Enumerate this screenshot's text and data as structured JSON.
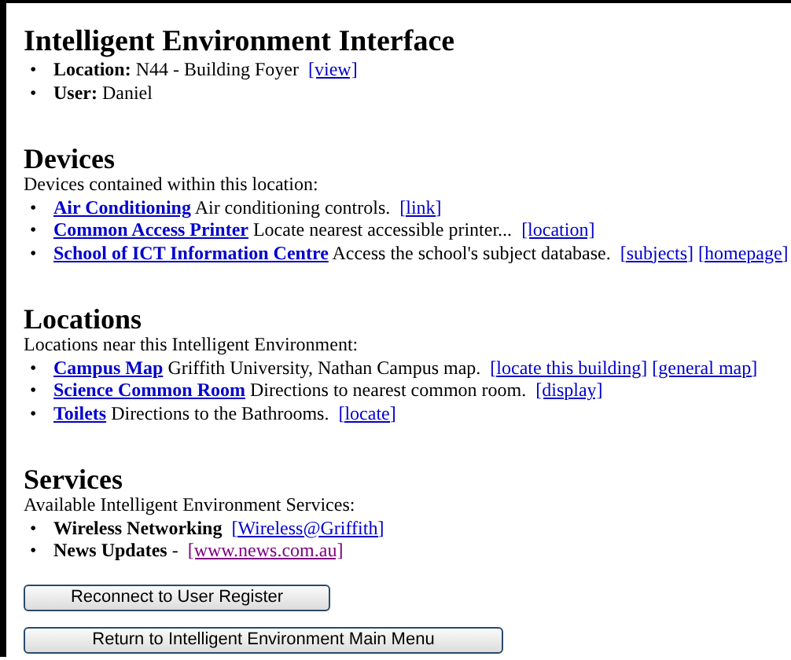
{
  "title": "Intelligent Environment Interface",
  "info": [
    {
      "bullet": "•",
      "label": "Location:",
      "text": "N44 - Building Foyer",
      "links": [
        {
          "label": "[view]",
          "visited": false
        }
      ]
    },
    {
      "bullet": "•",
      "label": "User:",
      "text": "Daniel"
    }
  ],
  "sections": [
    {
      "heading": "Devices",
      "intro": "Devices contained within this location:",
      "items": [
        {
          "bullet": "•",
          "title": "Air Conditioning",
          "title_link": true,
          "text": "Air conditioning controls.",
          "links": [
            {
              "label": "[link]",
              "visited": false
            }
          ]
        },
        {
          "bullet": "•",
          "title": "Common Access Printer",
          "title_link": true,
          "text": "Locate nearest accessible printer...",
          "links": [
            {
              "label": "[location]",
              "visited": false
            }
          ]
        },
        {
          "bullet": "•",
          "title": "School of ICT Information Centre",
          "title_link": true,
          "text": "Access the school's subject database.",
          "links": [
            {
              "label": "[subjects]",
              "visited": false
            },
            {
              "label": "[homepage]",
              "visited": false
            }
          ]
        }
      ]
    },
    {
      "heading": "Locations",
      "intro": "Locations near this Intelligent Environment:",
      "items": [
        {
          "bullet": "•",
          "title": "Campus Map",
          "title_link": true,
          "text": "Griffith University, Nathan Campus map.",
          "links": [
            {
              "label": "[locate this building]",
              "visited": false
            },
            {
              "label": "[general map]",
              "visited": false
            }
          ]
        },
        {
          "bullet": "•",
          "title": "Science Common Room",
          "title_link": true,
          "text": "Directions to nearest common room.",
          "links": [
            {
              "label": "[display]",
              "visited": false
            }
          ]
        },
        {
          "bullet": "•",
          "title": "Toilets",
          "title_link": true,
          "text": "Directions to the Bathrooms.",
          "links": [
            {
              "label": "[locate]",
              "visited": false
            }
          ]
        }
      ]
    },
    {
      "heading": "Services",
      "intro": "Available Intelligent Environment Services:",
      "items": [
        {
          "bullet": "•",
          "title": "Wireless Networking",
          "title_link": false,
          "links": [
            {
              "label": "[Wireless@Griffith]",
              "visited": false
            }
          ]
        },
        {
          "bullet": "•",
          "title": "News Updates",
          "title_link": false,
          "text": "-",
          "links": [
            {
              "label": "[www.news.com.au]",
              "visited": true
            }
          ]
        }
      ]
    }
  ],
  "buttons": [
    "Reconnect to User Register",
    "Return to Intelligent Environment Main Menu"
  ]
}
